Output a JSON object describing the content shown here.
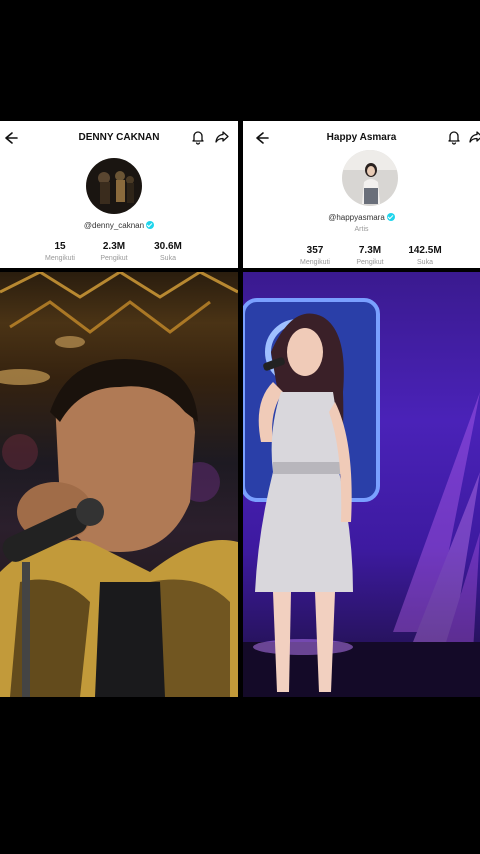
{
  "left_profile": {
    "title": "DENNY CAKNAN",
    "handle": "@denny_caknan",
    "stats": [
      {
        "value": "15",
        "label": "Mengikuti"
      },
      {
        "value": "2.3M",
        "label": "Pengikut"
      },
      {
        "value": "30.6M",
        "label": "Suka"
      }
    ]
  },
  "right_profile": {
    "title": "Happy Asmara",
    "handle": "@happyasmara",
    "subtitle": "Artis",
    "stats": [
      {
        "value": "357",
        "label": "Mengikuti"
      },
      {
        "value": "7.3M",
        "label": "Pengikut"
      },
      {
        "value": "142.5M",
        "label": "Suka"
      }
    ]
  },
  "colors": {
    "verified_badge": "#20d5ec",
    "background": "#000000"
  },
  "icons": [
    "back-arrow-icon",
    "bell-icon",
    "share-icon",
    "verified-icon"
  ]
}
